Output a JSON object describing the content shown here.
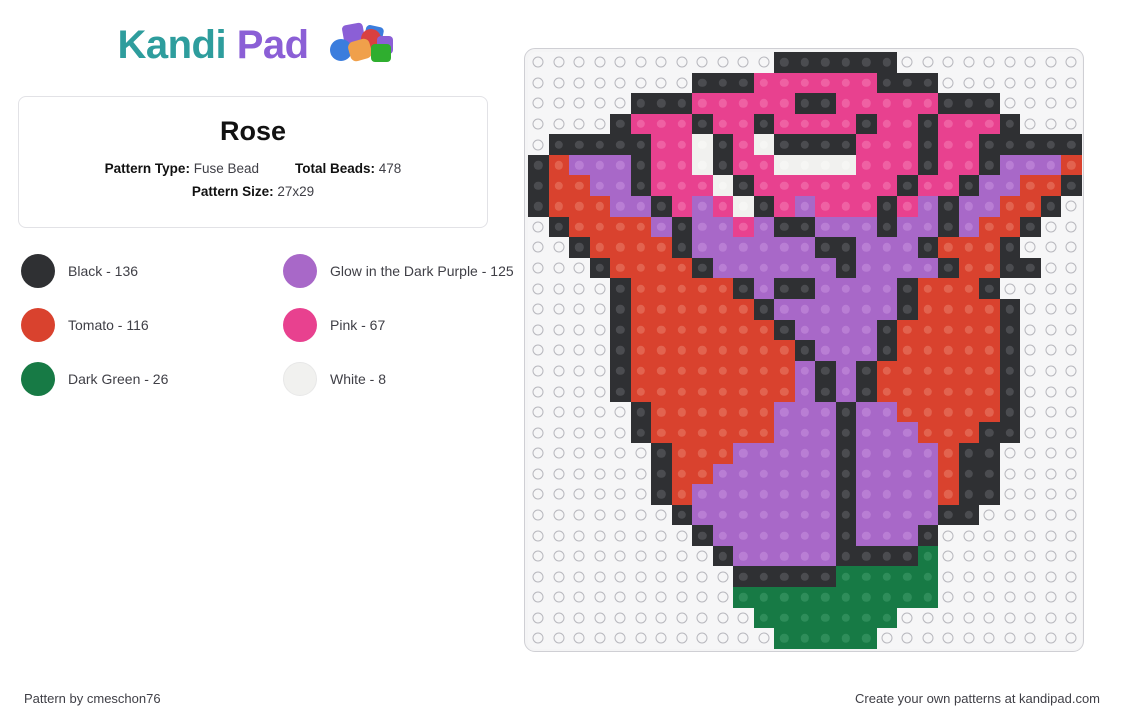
{
  "brand": {
    "name_part1": "Kandi",
    "name_part2": "Pad",
    "beads_icon": "kandi-beads-icon",
    "teal": "#2e9d9d",
    "purple": "#8b5fd6"
  },
  "info": {
    "title": "Rose",
    "pattern_type_label": "Pattern Type:",
    "pattern_type_value": "Fuse Bead",
    "total_beads_label": "Total Beads:",
    "total_beads_value": "478",
    "pattern_size_label": "Pattern Size:",
    "pattern_size_value": "27x29"
  },
  "legend": {
    "items": [
      {
        "label": "Black - 136",
        "name": "Black",
        "count": 136,
        "color": "#2f3033",
        "key": "K"
      },
      {
        "label": "Glow in the Dark Purple - 125",
        "name": "Glow in the Dark Purple",
        "count": 125,
        "color": "#a868c8",
        "key": "P"
      },
      {
        "label": "Tomato - 116",
        "name": "Tomato",
        "count": 116,
        "color": "#d9422e",
        "key": "T"
      },
      {
        "label": "Pink - 67",
        "name": "Pink",
        "count": 67,
        "color": "#e8418f",
        "key": "N"
      },
      {
        "label": "Dark Green - 26",
        "name": "Dark Green",
        "count": 26,
        "color": "#177a45",
        "key": "G"
      },
      {
        "label": "White - 8",
        "name": "White",
        "count": 8,
        "color": "#f1f1ef",
        "key": "W"
      }
    ]
  },
  "board": {
    "columns": 27,
    "rows": 29,
    "empty_key": "e",
    "legend_keys": {
      "K": "Black",
      "T": "Tomato",
      "G": "Dark Green",
      "P": "Glow in the Dark Purple",
      "N": "Pink",
      "W": "White",
      "e": "Empty"
    },
    "pattern": [
      "eeeeeeeeeeeeKKKKKKeeeeeeeee",
      "eeeeeeeeKKKNNNNNNKKKeeeeeee",
      "eeeeeKKKNNNNNKKNNNNNKKKeeee",
      "eeeeKNNNKNNKNNNNKNNKNNNKeee",
      "eKKKKKNNWKNWKKKKNNNKNNKKKKK",
      "KTPPPKNNWKNNWWWWNNNKNNKPPPT",
      "KTTPPKNNNWKNNNNNNNKNNKPPTTK",
      "KTTTPPKNPNWKNPNNNKNPKPPTTKe",
      "eKTTTTPKPPNPKKPPPKPPKPTTKee",
      "eeKTTTTKPPPPPPKKPPPKTTTKeee",
      "eeeKTTTTKPPPPPPKPPPPKTTKKee",
      "eeeeKTTTTTKPKKPPPPKTTTKeeee",
      "eeeeKTTTTTTKPPPPPPKTTTTKeee",
      "eeeeKTTTTTTTKPPPPKTTTTTKeee",
      "eeeeKTTTTTTTTKPPPKTTTTTKeee",
      "eeeeKTTTTTTTTPKPKTTTTTTKeee",
      "eeeeKTTTTTTTTPKPKTTTTTTKeee",
      "eeeeeKTTTTTTPPPKPPTTTTTKeee",
      "eeeeeKTTTTTTPPPKPPPTTTKKeee",
      "eeeeeeKTTTPPPPPKPPPPTKKeeee",
      "eeeeeeKTTPPPPPPKPPPPTKKeeee",
      "eeeeeeKTPPPPPPPKPPPPTKKeeee",
      "eeeeeeeKPPPPPPPKPPPPKKeeeee",
      "eeeeeeeeKPPPPPPKPPPKeeeeeee",
      "eeeeeeeeeKPPPPPKKKKGeeeeeee",
      "eeeeeeeeeeKKKKKGGGGGeeeeeee",
      "eeeeeeeeeeGGGGGGGGGGeeeeeee",
      "eeeeeeeeeeeGGGGGGGeeeeeeeee",
      "eeeeeeeeeeeeGGGGGeeeeeeeeee"
    ]
  },
  "footer": {
    "credit": "Pattern by cmeschon76",
    "promo": "Create your own patterns at kandipad.com"
  }
}
